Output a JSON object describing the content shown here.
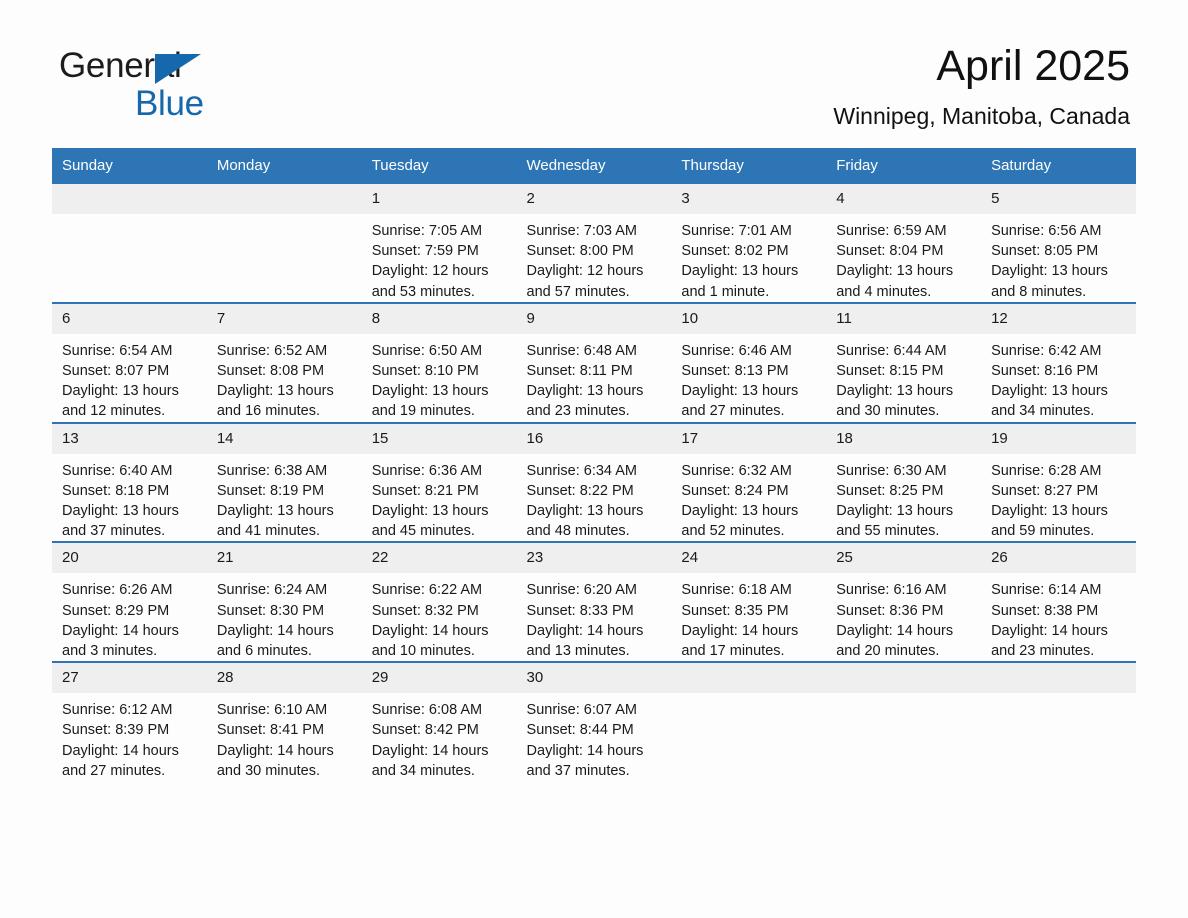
{
  "brand": {
    "name_part1": "General",
    "name_part2": "Blue",
    "accent_color": "#1668ad"
  },
  "header": {
    "title": "April 2025",
    "subtitle": "Winnipeg, Manitoba, Canada",
    "header_bg_color": "#2e75b6",
    "daynum_bg_color": "#efefef"
  },
  "weekday_headers": [
    "Sunday",
    "Monday",
    "Tuesday",
    "Wednesday",
    "Thursday",
    "Friday",
    "Saturday"
  ],
  "weeks": [
    [
      {
        "day": "",
        "sunrise": "",
        "sunset": "",
        "daylight1": "",
        "daylight2": ""
      },
      {
        "day": "",
        "sunrise": "",
        "sunset": "",
        "daylight1": "",
        "daylight2": ""
      },
      {
        "day": "1",
        "sunrise": "Sunrise: 7:05 AM",
        "sunset": "Sunset: 7:59 PM",
        "daylight1": "Daylight: 12 hours",
        "daylight2": "and 53 minutes."
      },
      {
        "day": "2",
        "sunrise": "Sunrise: 7:03 AM",
        "sunset": "Sunset: 8:00 PM",
        "daylight1": "Daylight: 12 hours",
        "daylight2": "and 57 minutes."
      },
      {
        "day": "3",
        "sunrise": "Sunrise: 7:01 AM",
        "sunset": "Sunset: 8:02 PM",
        "daylight1": "Daylight: 13 hours",
        "daylight2": "and 1 minute."
      },
      {
        "day": "4",
        "sunrise": "Sunrise: 6:59 AM",
        "sunset": "Sunset: 8:04 PM",
        "daylight1": "Daylight: 13 hours",
        "daylight2": "and 4 minutes."
      },
      {
        "day": "5",
        "sunrise": "Sunrise: 6:56 AM",
        "sunset": "Sunset: 8:05 PM",
        "daylight1": "Daylight: 13 hours",
        "daylight2": "and 8 minutes."
      }
    ],
    [
      {
        "day": "6",
        "sunrise": "Sunrise: 6:54 AM",
        "sunset": "Sunset: 8:07 PM",
        "daylight1": "Daylight: 13 hours",
        "daylight2": "and 12 minutes."
      },
      {
        "day": "7",
        "sunrise": "Sunrise: 6:52 AM",
        "sunset": "Sunset: 8:08 PM",
        "daylight1": "Daylight: 13 hours",
        "daylight2": "and 16 minutes."
      },
      {
        "day": "8",
        "sunrise": "Sunrise: 6:50 AM",
        "sunset": "Sunset: 8:10 PM",
        "daylight1": "Daylight: 13 hours",
        "daylight2": "and 19 minutes."
      },
      {
        "day": "9",
        "sunrise": "Sunrise: 6:48 AM",
        "sunset": "Sunset: 8:11 PM",
        "daylight1": "Daylight: 13 hours",
        "daylight2": "and 23 minutes."
      },
      {
        "day": "10",
        "sunrise": "Sunrise: 6:46 AM",
        "sunset": "Sunset: 8:13 PM",
        "daylight1": "Daylight: 13 hours",
        "daylight2": "and 27 minutes."
      },
      {
        "day": "11",
        "sunrise": "Sunrise: 6:44 AM",
        "sunset": "Sunset: 8:15 PM",
        "daylight1": "Daylight: 13 hours",
        "daylight2": "and 30 minutes."
      },
      {
        "day": "12",
        "sunrise": "Sunrise: 6:42 AM",
        "sunset": "Sunset: 8:16 PM",
        "daylight1": "Daylight: 13 hours",
        "daylight2": "and 34 minutes."
      }
    ],
    [
      {
        "day": "13",
        "sunrise": "Sunrise: 6:40 AM",
        "sunset": "Sunset: 8:18 PM",
        "daylight1": "Daylight: 13 hours",
        "daylight2": "and 37 minutes."
      },
      {
        "day": "14",
        "sunrise": "Sunrise: 6:38 AM",
        "sunset": "Sunset: 8:19 PM",
        "daylight1": "Daylight: 13 hours",
        "daylight2": "and 41 minutes."
      },
      {
        "day": "15",
        "sunrise": "Sunrise: 6:36 AM",
        "sunset": "Sunset: 8:21 PM",
        "daylight1": "Daylight: 13 hours",
        "daylight2": "and 45 minutes."
      },
      {
        "day": "16",
        "sunrise": "Sunrise: 6:34 AM",
        "sunset": "Sunset: 8:22 PM",
        "daylight1": "Daylight: 13 hours",
        "daylight2": "and 48 minutes."
      },
      {
        "day": "17",
        "sunrise": "Sunrise: 6:32 AM",
        "sunset": "Sunset: 8:24 PM",
        "daylight1": "Daylight: 13 hours",
        "daylight2": "and 52 minutes."
      },
      {
        "day": "18",
        "sunrise": "Sunrise: 6:30 AM",
        "sunset": "Sunset: 8:25 PM",
        "daylight1": "Daylight: 13 hours",
        "daylight2": "and 55 minutes."
      },
      {
        "day": "19",
        "sunrise": "Sunrise: 6:28 AM",
        "sunset": "Sunset: 8:27 PM",
        "daylight1": "Daylight: 13 hours",
        "daylight2": "and 59 minutes."
      }
    ],
    [
      {
        "day": "20",
        "sunrise": "Sunrise: 6:26 AM",
        "sunset": "Sunset: 8:29 PM",
        "daylight1": "Daylight: 14 hours",
        "daylight2": "and 3 minutes."
      },
      {
        "day": "21",
        "sunrise": "Sunrise: 6:24 AM",
        "sunset": "Sunset: 8:30 PM",
        "daylight1": "Daylight: 14 hours",
        "daylight2": "and 6 minutes."
      },
      {
        "day": "22",
        "sunrise": "Sunrise: 6:22 AM",
        "sunset": "Sunset: 8:32 PM",
        "daylight1": "Daylight: 14 hours",
        "daylight2": "and 10 minutes."
      },
      {
        "day": "23",
        "sunrise": "Sunrise: 6:20 AM",
        "sunset": "Sunset: 8:33 PM",
        "daylight1": "Daylight: 14 hours",
        "daylight2": "and 13 minutes."
      },
      {
        "day": "24",
        "sunrise": "Sunrise: 6:18 AM",
        "sunset": "Sunset: 8:35 PM",
        "daylight1": "Daylight: 14 hours",
        "daylight2": "and 17 minutes."
      },
      {
        "day": "25",
        "sunrise": "Sunrise: 6:16 AM",
        "sunset": "Sunset: 8:36 PM",
        "daylight1": "Daylight: 14 hours",
        "daylight2": "and 20 minutes."
      },
      {
        "day": "26",
        "sunrise": "Sunrise: 6:14 AM",
        "sunset": "Sunset: 8:38 PM",
        "daylight1": "Daylight: 14 hours",
        "daylight2": "and 23 minutes."
      }
    ],
    [
      {
        "day": "27",
        "sunrise": "Sunrise: 6:12 AM",
        "sunset": "Sunset: 8:39 PM",
        "daylight1": "Daylight: 14 hours",
        "daylight2": "and 27 minutes."
      },
      {
        "day": "28",
        "sunrise": "Sunrise: 6:10 AM",
        "sunset": "Sunset: 8:41 PM",
        "daylight1": "Daylight: 14 hours",
        "daylight2": "and 30 minutes."
      },
      {
        "day": "29",
        "sunrise": "Sunrise: 6:08 AM",
        "sunset": "Sunset: 8:42 PM",
        "daylight1": "Daylight: 14 hours",
        "daylight2": "and 34 minutes."
      },
      {
        "day": "30",
        "sunrise": "Sunrise: 6:07 AM",
        "sunset": "Sunset: 8:44 PM",
        "daylight1": "Daylight: 14 hours",
        "daylight2": "and 37 minutes."
      },
      {
        "day": "",
        "sunrise": "",
        "sunset": "",
        "daylight1": "",
        "daylight2": ""
      },
      {
        "day": "",
        "sunrise": "",
        "sunset": "",
        "daylight1": "",
        "daylight2": ""
      },
      {
        "day": "",
        "sunrise": "",
        "sunset": "",
        "daylight1": "",
        "daylight2": ""
      }
    ]
  ]
}
